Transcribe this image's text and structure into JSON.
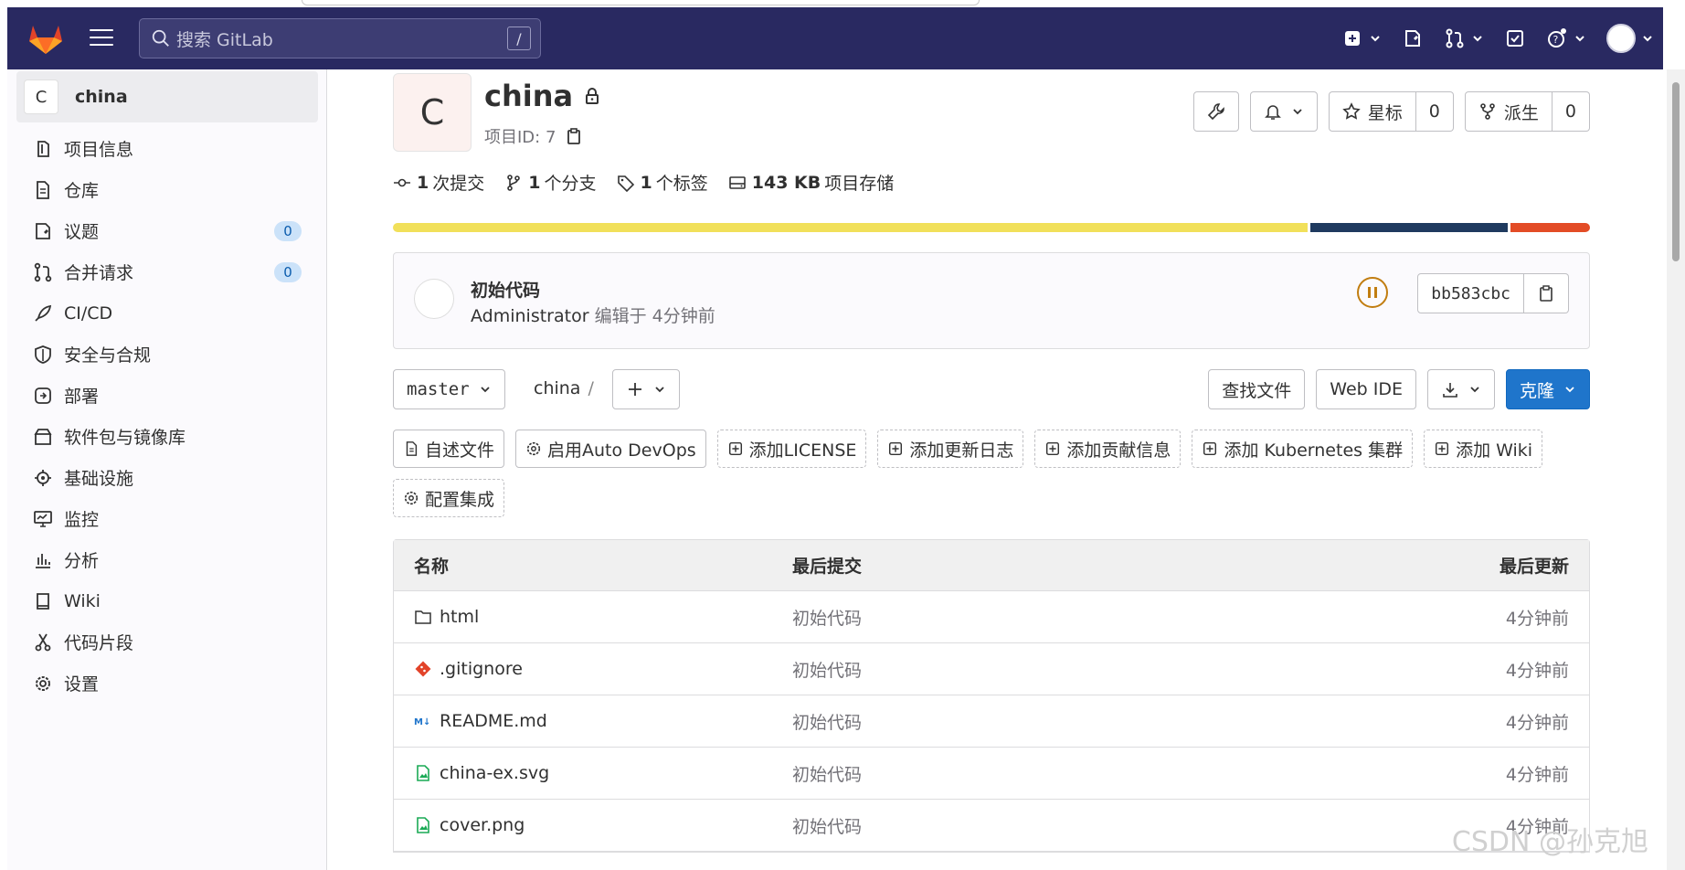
{
  "topbar": {
    "search_placeholder": "搜索 GitLab",
    "search_shortcut": "/"
  },
  "sidebar": {
    "project_avatar_letter": "C",
    "project_name": "china",
    "items": [
      {
        "label": "项目信息",
        "icon": "info-icon"
      },
      {
        "label": "仓库",
        "icon": "document-icon"
      },
      {
        "label": "议题",
        "icon": "issues-icon",
        "badge": "0"
      },
      {
        "label": "合并请求",
        "icon": "merge-request-icon",
        "badge": "0"
      },
      {
        "label": "CI/CD",
        "icon": "rocket-icon"
      },
      {
        "label": "安全与合规",
        "icon": "shield-icon"
      },
      {
        "label": "部署",
        "icon": "deploy-icon"
      },
      {
        "label": "软件包与镜像库",
        "icon": "package-icon"
      },
      {
        "label": "基础设施",
        "icon": "cloud-gear-icon"
      },
      {
        "label": "监控",
        "icon": "monitor-icon"
      },
      {
        "label": "分析",
        "icon": "chart-icon"
      },
      {
        "label": "Wiki",
        "icon": "book-icon"
      },
      {
        "label": "代码片段",
        "icon": "scissors-icon"
      },
      {
        "label": "设置",
        "icon": "gear-icon"
      }
    ]
  },
  "project": {
    "avatar_letter": "C",
    "title": "china",
    "id_label": "项目ID: 7",
    "star_label": "星标",
    "star_count": "0",
    "fork_label": "派生",
    "fork_count": "0"
  },
  "stats": {
    "commits_num": "1",
    "commits_label": "次提交",
    "branches_num": "1",
    "branches_label": "个分支",
    "tags_num": "1",
    "tags_label": "个标签",
    "storage_num": "143 KB",
    "storage_label": "项目存储"
  },
  "language_bar": [
    {
      "color": "#f1e05a",
      "share": 0.768
    },
    {
      "color": "#1f3a5f",
      "share": 0.165
    },
    {
      "color": "#e34c26",
      "share": 0.067
    }
  ],
  "last_commit": {
    "title": "初始代码",
    "author": "Administrator",
    "meta": "编辑于 4分钟前",
    "sha": "bb583cbc"
  },
  "toolbar": {
    "branch": "master",
    "path": "china",
    "path_sep": "/",
    "find_file": "查找文件",
    "web_ide": "Web IDE",
    "clone": "克隆"
  },
  "actions": [
    {
      "label": "自述文件",
      "icon": "document-icon",
      "dashed": false
    },
    {
      "label": "启用Auto DevOps",
      "icon": "gear-icon",
      "dashed": false
    },
    {
      "label": "添加LICENSE",
      "icon": "plus-square-icon",
      "dashed": true
    },
    {
      "label": "添加更新日志",
      "icon": "plus-square-icon",
      "dashed": true
    },
    {
      "label": "添加贡献信息",
      "icon": "plus-square-icon",
      "dashed": true
    },
    {
      "label": "添加 Kubernetes 集群",
      "icon": "plus-square-icon",
      "dashed": true
    },
    {
      "label": "添加 Wiki",
      "icon": "plus-square-icon",
      "dashed": true
    },
    {
      "label": "配置集成",
      "icon": "gear-icon",
      "dashed": true
    }
  ],
  "files": {
    "headers": {
      "name": "名称",
      "last_commit": "最后提交",
      "last_update": "最后更新"
    },
    "rows": [
      {
        "name": "html",
        "icon": "folder-icon",
        "commit": "初始代码",
        "updated": "4分钟前"
      },
      {
        "name": ".gitignore",
        "icon": "git-icon",
        "commit": "初始代码",
        "updated": "4分钟前"
      },
      {
        "name": "README.md",
        "icon": "markdown-icon",
        "commit": "初始代码",
        "updated": "4分钟前"
      },
      {
        "name": "china-ex.svg",
        "icon": "image-file-icon",
        "commit": "初始代码",
        "updated": "4分钟前"
      },
      {
        "name": "cover.png",
        "icon": "image-file-icon",
        "commit": "初始代码",
        "updated": "4分钟前"
      }
    ]
  },
  "watermark": "CSDN @孙克旭"
}
